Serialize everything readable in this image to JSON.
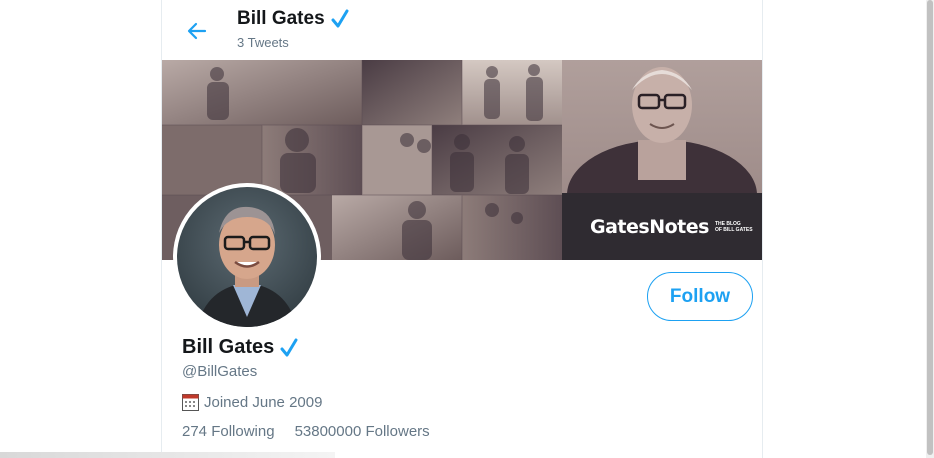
{
  "header": {
    "name": "Bill Gates",
    "tweet_count": "3 Tweets",
    "back_icon": "arrow-left-icon"
  },
  "banner": {
    "brand_text": "GatesNotes",
    "brand_tagline_1": "THE BLOG",
    "brand_tagline_2": "OF BILL GATES"
  },
  "profile": {
    "name": "Bill Gates",
    "handle": "@BillGates",
    "joined": "Joined June 2009",
    "following": "274 Following",
    "followers": "53800000 Followers",
    "verified_icon": "verified-check-icon",
    "calendar_icon": "calendar-icon"
  },
  "actions": {
    "follow_label": "Follow"
  },
  "colors": {
    "accent": "#1da1f2",
    "muted_text": "#657786",
    "border": "#e6ecf0"
  }
}
